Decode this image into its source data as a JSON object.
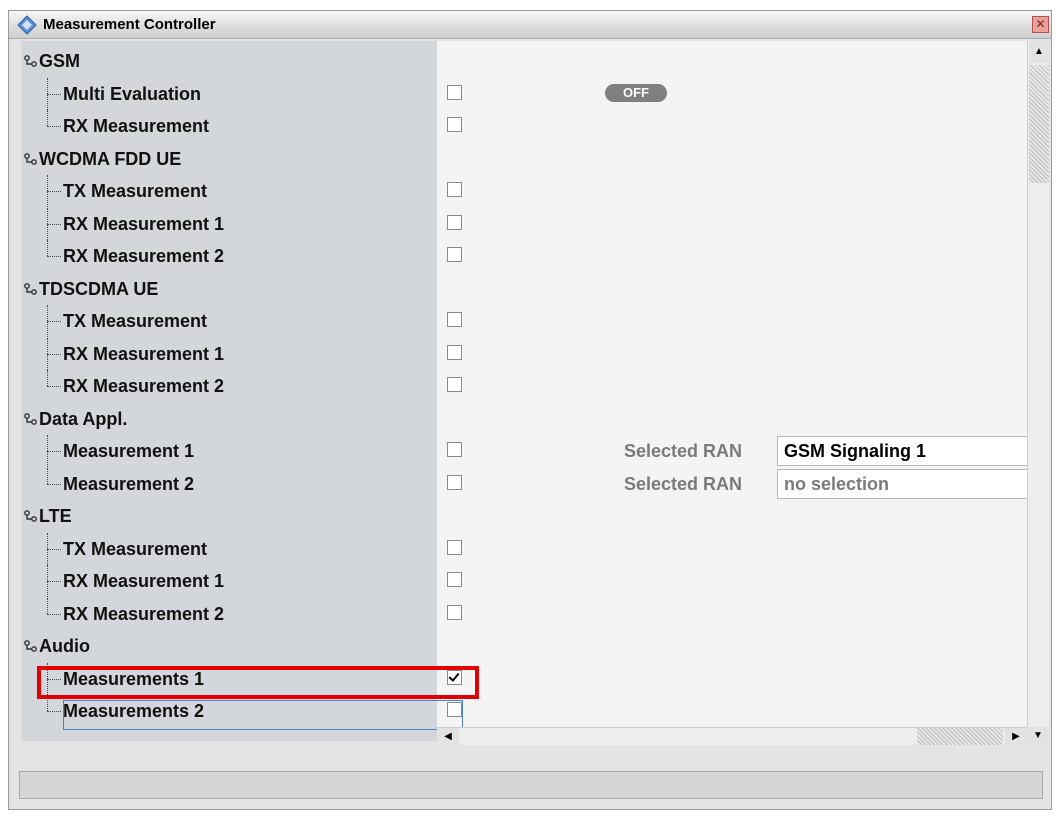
{
  "window": {
    "title": "Measurement Controller",
    "close_icon": "close-icon"
  },
  "tree": [
    {
      "label": "GSM",
      "type": "parent"
    },
    {
      "label": "Multi Evaluation",
      "type": "child",
      "checked": false,
      "toggle": "OFF"
    },
    {
      "label": "RX Measurement",
      "type": "child",
      "checked": false
    },
    {
      "label": "WCDMA FDD UE",
      "type": "parent"
    },
    {
      "label": "TX Measurement",
      "type": "child",
      "checked": false
    },
    {
      "label": "RX Measurement 1",
      "type": "child",
      "checked": false
    },
    {
      "label": "RX Measurement 2",
      "type": "child",
      "checked": false
    },
    {
      "label": "TDSCDMA UE",
      "type": "parent"
    },
    {
      "label": "TX Measurement",
      "type": "child",
      "checked": false
    },
    {
      "label": "RX Measurement 1",
      "type": "child",
      "checked": false
    },
    {
      "label": "RX Measurement 2",
      "type": "child",
      "checked": false
    },
    {
      "label": "Data Appl.",
      "type": "parent"
    },
    {
      "label": "Measurement 1",
      "type": "child",
      "checked": false,
      "ran_label": "Selected RAN",
      "ran_value": "GSM Signaling 1"
    },
    {
      "label": "Measurement 2",
      "type": "child",
      "checked": false,
      "ran_label": "Selected RAN",
      "ran_value": "no selection",
      "ran_dim": true
    },
    {
      "label": "LTE",
      "type": "parent"
    },
    {
      "label": "TX Measurement",
      "type": "child",
      "checked": false
    },
    {
      "label": "RX Measurement 1",
      "type": "child",
      "checked": false
    },
    {
      "label": "RX Measurement 2",
      "type": "child",
      "checked": false
    },
    {
      "label": "Audio",
      "type": "parent"
    },
    {
      "label": "Measurements 1",
      "type": "child",
      "checked": true,
      "highlighted": true
    },
    {
      "label": "Measurements 2",
      "type": "child",
      "checked": false,
      "focused": true
    }
  ],
  "colors": {
    "highlight": "#e00000",
    "tree_bg": "#d3d6da",
    "focus": "#4a7fd6"
  }
}
